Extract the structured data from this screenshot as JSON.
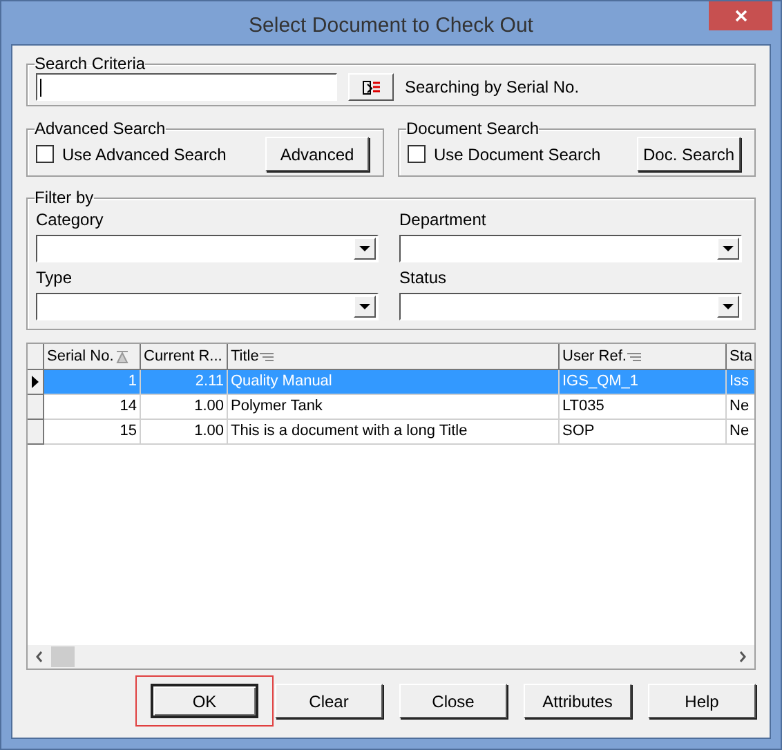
{
  "window": {
    "title": "Select Document to Check Out"
  },
  "search_criteria": {
    "label": "Search Criteria",
    "hint": "Searching by Serial No."
  },
  "advanced_search": {
    "label": "Advanced Search",
    "checkbox": {
      "label": "Use Advanced Search",
      "checked": false
    },
    "button": "Advanced"
  },
  "document_search": {
    "label": "Document Search",
    "checkbox": {
      "label": "Use Document Search",
      "checked": false
    },
    "button": "Doc. Search"
  },
  "filter": {
    "label": "Filter by",
    "fields": [
      {
        "label": "Category"
      },
      {
        "label": "Department"
      },
      {
        "label": "Type"
      },
      {
        "label": "Status"
      }
    ]
  },
  "table": {
    "columns": [
      {
        "label": "Serial No.",
        "kind": "sort"
      },
      {
        "label": "Current R...",
        "kind": "plain"
      },
      {
        "label": "Title",
        "kind": "filter"
      },
      {
        "label": "User Ref.",
        "kind": "filter"
      },
      {
        "label": "Sta",
        "kind": "plain"
      }
    ],
    "rows": [
      {
        "selected": true,
        "cells": [
          "1",
          "2.11",
          "Quality Manual",
          "IGS_QM_1",
          "Iss"
        ]
      },
      {
        "selected": false,
        "cells": [
          "14",
          "1.00",
          "Polymer Tank",
          "LT035",
          "Ne"
        ]
      },
      {
        "selected": false,
        "cells": [
          "15",
          "1.00",
          "This is a document with a long Title",
          "SOP",
          "Ne"
        ]
      }
    ]
  },
  "buttons": [
    {
      "label": "OK",
      "focused": true
    },
    {
      "label": "Clear",
      "focused": false
    },
    {
      "label": "Close",
      "focused": false
    },
    {
      "label": "Attributes",
      "focused": false
    },
    {
      "label": "Help",
      "focused": false
    }
  ]
}
